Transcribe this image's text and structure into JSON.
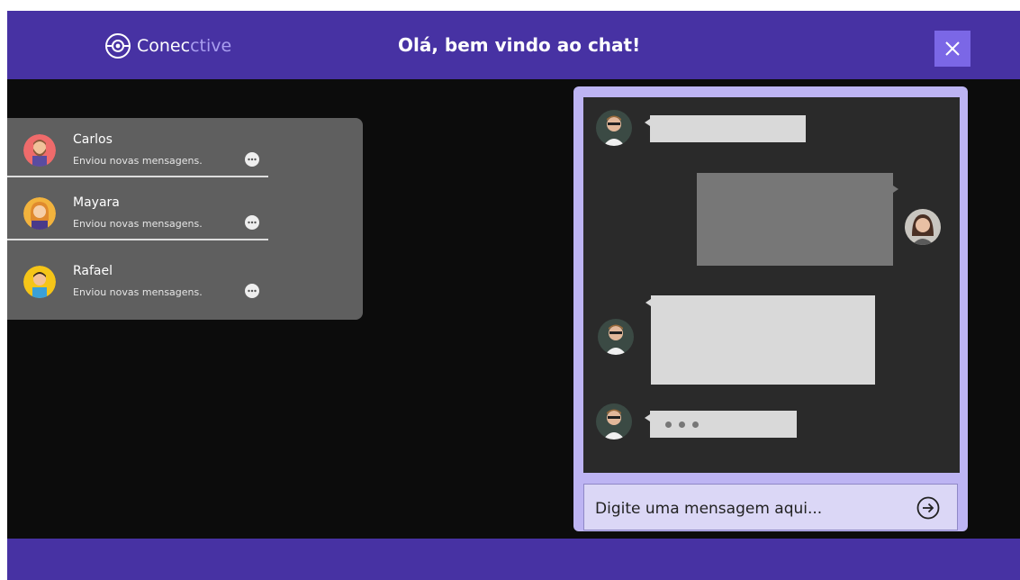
{
  "app": {
    "logo_text_main": "Conec",
    "logo_text_light": "ctive",
    "title": "Olá, bem vindo ao chat!"
  },
  "colors": {
    "header": "#4732a3",
    "accent": "#7b67e6",
    "chat_frame": "#bdb4f3",
    "background": "#0c0c0c"
  },
  "contacts": [
    {
      "name": "Carlos",
      "status": "Enviou novas mensagens.",
      "avatar_icon": "man-beard-avatar-icon"
    },
    {
      "name": "Mayara",
      "status": "Enviou novas mensagens.",
      "avatar_icon": "woman-avatar-icon"
    },
    {
      "name": "Rafael",
      "status": "Enviou novas mensagens.",
      "avatar_icon": "boy-avatar-icon"
    }
  ],
  "chat": {
    "input_placeholder": "Digite uma mensagem aqui...",
    "typing_indicator": "•••"
  },
  "icons": {
    "logo": "globe-logo-icon",
    "close": "close-icon",
    "send": "arrow-right-circle-icon",
    "more": "more-dots-icon"
  }
}
